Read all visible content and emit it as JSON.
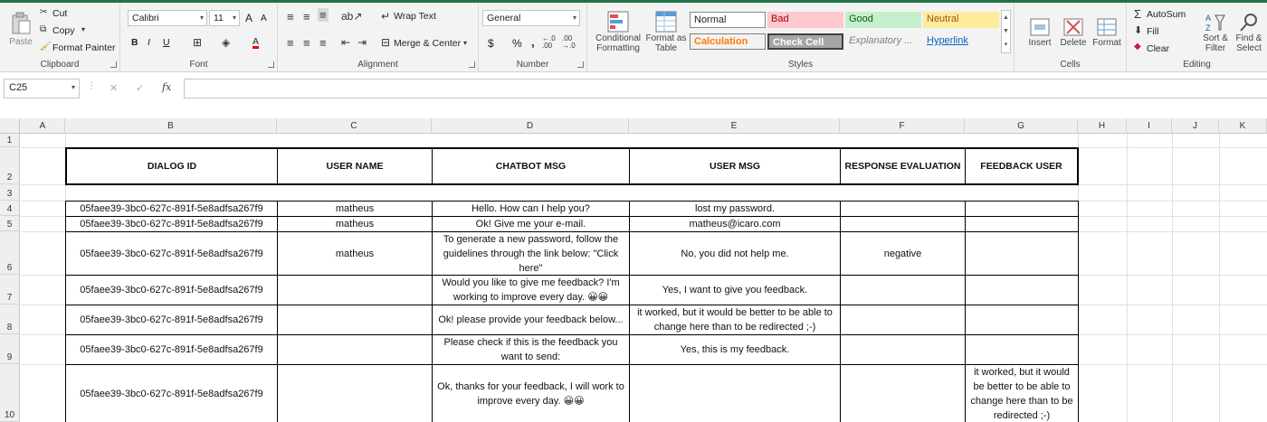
{
  "ribbon": {
    "clipboard": {
      "paste": "Paste",
      "cut": "Cut",
      "copy": "Copy",
      "format_painter": "Format Painter",
      "label": "Clipboard"
    },
    "font": {
      "name": "Calibri",
      "size": "11",
      "bold": "B",
      "italic": "I",
      "underline": "U",
      "grow": "A",
      "shrink": "A",
      "font_color": "A",
      "label": "Font"
    },
    "alignment": {
      "wrap_text": "Wrap Text",
      "merge_center": "Merge & Center",
      "label": "Alignment"
    },
    "number": {
      "format": "General",
      "currency": "$",
      "percent": "%",
      "comma": ",",
      "inc_decimal": "←.0 .00",
      "dec_decimal": ".00 →.0",
      "label": "Number"
    },
    "styles": {
      "conditional_formatting": [
        "Conditional",
        "Formatting"
      ],
      "format_as_table": [
        "Format as",
        "Table"
      ],
      "gallery": [
        "Normal",
        "Bad",
        "Good",
        "Neutral",
        "Calculation",
        "Check Cell",
        "Explanatory ...",
        "Hyperlink"
      ],
      "label": "Styles"
    },
    "cells": {
      "insert": "Insert",
      "delete": "Delete",
      "format": "Format",
      "label": "Cells"
    },
    "editing": {
      "autosum": "AutoSum",
      "fill": "Fill",
      "clear": "Clear",
      "sort_filter": [
        "Sort &",
        "Filter"
      ],
      "find_select": [
        "Find &",
        "Select"
      ],
      "label": "Editing"
    }
  },
  "formula_bar": {
    "name_box": "C25",
    "fx": "fx",
    "cancel": "✕",
    "enter": "✓",
    "value": ""
  },
  "grid": {
    "columns": [
      "A",
      "B",
      "C",
      "D",
      "E",
      "F",
      "G",
      "H",
      "I",
      "J",
      "K"
    ],
    "rows": [
      "1",
      "2",
      "3",
      "4",
      "5",
      "6",
      "7",
      "8",
      "9",
      "10"
    ],
    "headers": [
      "DIALOG ID",
      "USER NAME",
      "CHATBOT MSG",
      "USER MSG",
      "RESPONSE EVALUATION",
      "FEEDBACK  USER"
    ],
    "records": [
      {
        "id": "05faee39-3bc0-627c-891f-5e8adfsa267f9",
        "user": "matheus",
        "bot": "Hello. How can I help you?",
        "msg": "lost my password.",
        "eval": "",
        "feedback": ""
      },
      {
        "id": "05faee39-3bc0-627c-891f-5e8adfsa267f9",
        "user": "matheus",
        "bot": "Ok! Give me your e-mail.",
        "msg": "matheus@icaro.com",
        "eval": "",
        "feedback": ""
      },
      {
        "id": "05faee39-3bc0-627c-891f-5e8adfsa267f9",
        "user": "matheus",
        "bot": "To generate a new password, follow the guidelines through the link below: \"Click here\"",
        "msg": "No, you did not help me.",
        "eval": "negative",
        "feedback": ""
      },
      {
        "id": "05faee39-3bc0-627c-891f-5e8adfsa267f9",
        "user": "",
        "bot": "Would you like to give me feedback? I'm working to improve every day. 😀😀",
        "msg": "Yes, I want to give you feedback.",
        "eval": "",
        "feedback": ""
      },
      {
        "id": "05faee39-3bc0-627c-891f-5e8adfsa267f9",
        "user": "",
        "bot": "Ok! please provide your feedback below...",
        "msg": "it worked, but it would be better to be able to change here than to be redirected ;-)",
        "eval": "",
        "feedback": ""
      },
      {
        "id": "05faee39-3bc0-627c-891f-5e8adfsa267f9",
        "user": "",
        "bot": "Please check if this is the feedback you want to send:",
        "msg": "Yes, this is my feedback.",
        "eval": "",
        "feedback": ""
      },
      {
        "id": "05faee39-3bc0-627c-891f-5e8adfsa267f9",
        "user": "",
        "bot": "Ok, thanks for your feedback, I will work to improve every day. 😀😀",
        "msg": "",
        "eval": "",
        "feedback": "it worked, but it would be better to be able to change here than to be redirected ;-)"
      }
    ]
  },
  "colors": {
    "excel_green": "#217346",
    "bad_bg": "#ffc7ce",
    "bad_fg": "#9c0006",
    "good_bg": "#c6efce",
    "good_fg": "#006100",
    "neutral_bg": "#ffeb9c",
    "neutral_fg": "#9c5700",
    "calc_fg": "#fa7d00",
    "check_bg": "#a5a5a5",
    "hyperlink": "#0563c1"
  }
}
